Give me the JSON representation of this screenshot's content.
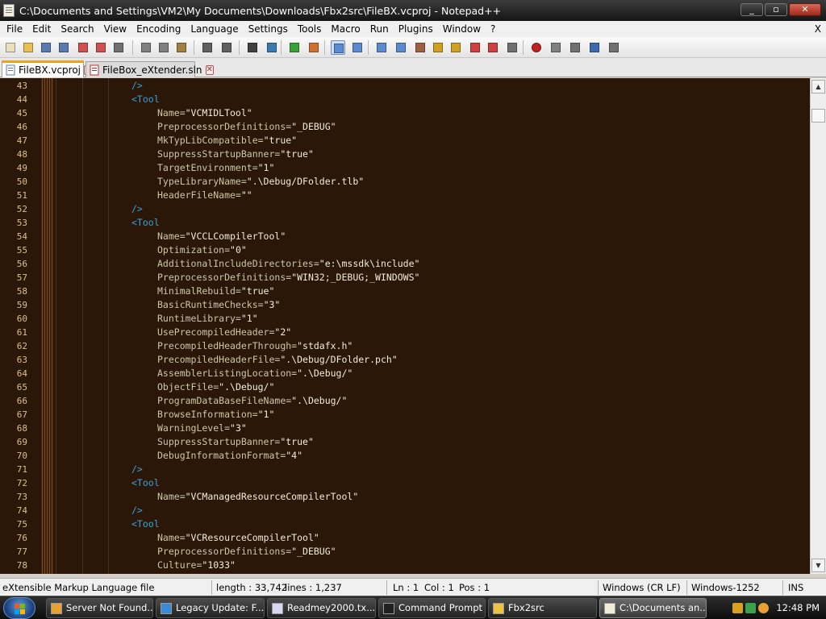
{
  "window": {
    "title": "C:\\Documents and Settings\\VM2\\My Documents\\Downloads\\Fbx2src\\FileBX.vcproj - Notepad++",
    "buttons": {
      "minimize": "_",
      "maximize": "▫",
      "close": "✕"
    }
  },
  "menu": {
    "items": [
      "File",
      "Edit",
      "Search",
      "View",
      "Encoding",
      "Language",
      "Settings",
      "Tools",
      "Macro",
      "Run",
      "Plugins",
      "Window",
      "?"
    ],
    "close": "X"
  },
  "toolbar": {
    "icons": [
      "new-file-icon",
      "open-file-icon",
      "save-icon",
      "save-all-icon",
      "close-icon",
      "close-all-icon",
      "print-icon",
      "cut-icon",
      "copy-icon",
      "paste-icon",
      "undo-icon",
      "redo-icon",
      "find-icon",
      "replace-icon",
      "zoom-in-icon",
      "zoom-out-icon",
      "sync-vertical-icon",
      "sync-horizontal-icon",
      "word-wrap-icon",
      "show-all-chars-icon",
      "indent-guide-icon",
      "user-language-icon",
      "doc-map-icon",
      "function-list-icon",
      "folder-workspace-icon",
      "monitoring-icon",
      "record-macro-icon",
      "stop-macro-icon",
      "play-macro-icon",
      "run-multiple-macro-icon",
      "save-macro-icon"
    ]
  },
  "tabs": [
    {
      "label": "FileBX.vcproj",
      "active": true
    },
    {
      "label": "FileBox_eXtender.sln",
      "active": false
    }
  ],
  "editor": {
    "colors": {
      "background": "#2b1708",
      "tag": "#3aa0d8",
      "attribute": "#cfc6a8",
      "value": "#f2ecd8",
      "line_number": "#d8c08c"
    },
    "lines": [
      {
        "n": "43",
        "indent": 3,
        "parts": [
          {
            "t": "tag",
            "s": "/>"
          }
        ]
      },
      {
        "n": "44",
        "indent": 3,
        "parts": [
          {
            "t": "tag",
            "s": "<Tool"
          }
        ]
      },
      {
        "n": "45",
        "indent": 4,
        "parts": [
          {
            "t": "attr",
            "s": "Name="
          },
          {
            "t": "val",
            "s": "\"VCMIDLTool\""
          }
        ]
      },
      {
        "n": "46",
        "indent": 4,
        "parts": [
          {
            "t": "attr",
            "s": "PreprocessorDefinitions="
          },
          {
            "t": "val",
            "s": "\"_DEBUG\""
          }
        ]
      },
      {
        "n": "47",
        "indent": 4,
        "parts": [
          {
            "t": "attr",
            "s": "MkTypLibCompatible="
          },
          {
            "t": "val",
            "s": "\"true\""
          }
        ]
      },
      {
        "n": "48",
        "indent": 4,
        "parts": [
          {
            "t": "attr",
            "s": "SuppressStartupBanner="
          },
          {
            "t": "val",
            "s": "\"true\""
          }
        ]
      },
      {
        "n": "49",
        "indent": 4,
        "parts": [
          {
            "t": "attr",
            "s": "TargetEnvironment="
          },
          {
            "t": "val",
            "s": "\"1\""
          }
        ]
      },
      {
        "n": "50",
        "indent": 4,
        "parts": [
          {
            "t": "attr",
            "s": "TypeLibraryName="
          },
          {
            "t": "val",
            "s": "\".\\Debug/DFolder.tlb\""
          }
        ]
      },
      {
        "n": "51",
        "indent": 4,
        "parts": [
          {
            "t": "attr",
            "s": "HeaderFileName="
          },
          {
            "t": "val",
            "s": "\"\""
          }
        ]
      },
      {
        "n": "52",
        "indent": 3,
        "parts": [
          {
            "t": "tag",
            "s": "/>"
          }
        ]
      },
      {
        "n": "53",
        "indent": 3,
        "parts": [
          {
            "t": "tag",
            "s": "<Tool"
          }
        ]
      },
      {
        "n": "54",
        "indent": 4,
        "parts": [
          {
            "t": "attr",
            "s": "Name="
          },
          {
            "t": "val",
            "s": "\"VCCLCompilerTool\""
          }
        ]
      },
      {
        "n": "55",
        "indent": 4,
        "parts": [
          {
            "t": "attr",
            "s": "Optimization="
          },
          {
            "t": "val",
            "s": "\"0\""
          }
        ]
      },
      {
        "n": "56",
        "indent": 4,
        "parts": [
          {
            "t": "attr",
            "s": "AdditionalIncludeDirectories="
          },
          {
            "t": "val",
            "s": "\"e:\\mssdk\\include\""
          }
        ]
      },
      {
        "n": "57",
        "indent": 4,
        "parts": [
          {
            "t": "attr",
            "s": "PreprocessorDefinitions="
          },
          {
            "t": "val",
            "s": "\"WIN32;_DEBUG;_WINDOWS\""
          }
        ]
      },
      {
        "n": "58",
        "indent": 4,
        "parts": [
          {
            "t": "attr",
            "s": "MinimalRebuild="
          },
          {
            "t": "val",
            "s": "\"true\""
          }
        ]
      },
      {
        "n": "59",
        "indent": 4,
        "parts": [
          {
            "t": "attr",
            "s": "BasicRuntimeChecks="
          },
          {
            "t": "val",
            "s": "\"3\""
          }
        ]
      },
      {
        "n": "60",
        "indent": 4,
        "parts": [
          {
            "t": "attr",
            "s": "RuntimeLibrary="
          },
          {
            "t": "val",
            "s": "\"1\""
          }
        ]
      },
      {
        "n": "61",
        "indent": 4,
        "parts": [
          {
            "t": "attr",
            "s": "UsePrecompiledHeader="
          },
          {
            "t": "val",
            "s": "\"2\""
          }
        ]
      },
      {
        "n": "62",
        "indent": 4,
        "parts": [
          {
            "t": "attr",
            "s": "PrecompiledHeaderThrough="
          },
          {
            "t": "val",
            "s": "\"stdafx.h\""
          }
        ]
      },
      {
        "n": "63",
        "indent": 4,
        "parts": [
          {
            "t": "attr",
            "s": "PrecompiledHeaderFile="
          },
          {
            "t": "val",
            "s": "\".\\Debug/DFolder.pch\""
          }
        ]
      },
      {
        "n": "64",
        "indent": 4,
        "parts": [
          {
            "t": "attr",
            "s": "AssemblerListingLocation="
          },
          {
            "t": "val",
            "s": "\".\\Debug/\""
          }
        ]
      },
      {
        "n": "65",
        "indent": 4,
        "parts": [
          {
            "t": "attr",
            "s": "ObjectFile="
          },
          {
            "t": "val",
            "s": "\".\\Debug/\""
          }
        ]
      },
      {
        "n": "66",
        "indent": 4,
        "parts": [
          {
            "t": "attr",
            "s": "ProgramDataBaseFileName="
          },
          {
            "t": "val",
            "s": "\".\\Debug/\""
          }
        ]
      },
      {
        "n": "67",
        "indent": 4,
        "parts": [
          {
            "t": "attr",
            "s": "BrowseInformation="
          },
          {
            "t": "val",
            "s": "\"1\""
          }
        ]
      },
      {
        "n": "68",
        "indent": 4,
        "parts": [
          {
            "t": "attr",
            "s": "WarningLevel="
          },
          {
            "t": "val",
            "s": "\"3\""
          }
        ]
      },
      {
        "n": "69",
        "indent": 4,
        "parts": [
          {
            "t": "attr",
            "s": "SuppressStartupBanner="
          },
          {
            "t": "val",
            "s": "\"true\""
          }
        ]
      },
      {
        "n": "70",
        "indent": 4,
        "parts": [
          {
            "t": "attr",
            "s": "DebugInformationFormat="
          },
          {
            "t": "val",
            "s": "\"4\""
          }
        ]
      },
      {
        "n": "71",
        "indent": 3,
        "parts": [
          {
            "t": "tag",
            "s": "/>"
          }
        ]
      },
      {
        "n": "72",
        "indent": 3,
        "parts": [
          {
            "t": "tag",
            "s": "<Tool"
          }
        ]
      },
      {
        "n": "73",
        "indent": 4,
        "parts": [
          {
            "t": "attr",
            "s": "Name="
          },
          {
            "t": "val",
            "s": "\"VCManagedResourceCompilerTool\""
          }
        ]
      },
      {
        "n": "74",
        "indent": 3,
        "parts": [
          {
            "t": "tag",
            "s": "/>"
          }
        ]
      },
      {
        "n": "75",
        "indent": 3,
        "parts": [
          {
            "t": "tag",
            "s": "<Tool"
          }
        ]
      },
      {
        "n": "76",
        "indent": 4,
        "parts": [
          {
            "t": "attr",
            "s": "Name="
          },
          {
            "t": "val",
            "s": "\"VCResourceCompilerTool\""
          }
        ]
      },
      {
        "n": "77",
        "indent": 4,
        "parts": [
          {
            "t": "attr",
            "s": "PreprocessorDefinitions="
          },
          {
            "t": "val",
            "s": "\"_DEBUG\""
          }
        ]
      },
      {
        "n": "78",
        "indent": 4,
        "parts": [
          {
            "t": "attr",
            "s": "Culture="
          },
          {
            "t": "val",
            "s": "\"1033\""
          }
        ]
      }
    ]
  },
  "status": {
    "filetype": "eXtensible Markup Language file",
    "length": "length : 33,742",
    "lines": "lines : 1,237",
    "ln": "Ln : 1",
    "col": "Col : 1",
    "pos": "Pos : 1",
    "eol": "Windows (CR LF)",
    "encoding": "Windows-1252",
    "mode": "INS"
  },
  "taskbar": {
    "tasks": [
      {
        "label": "Server Not Found...",
        "icon": "browser-icon",
        "active": false
      },
      {
        "label": "Legacy Update: F...",
        "icon": "internet-explorer-icon",
        "active": false
      },
      {
        "label": "Readmey2000.tx...",
        "icon": "text-document-icon",
        "active": false
      },
      {
        "label": "Command Prompt",
        "icon": "command-prompt-icon",
        "active": false
      },
      {
        "label": "Fbx2src",
        "icon": "folder-icon",
        "active": false
      },
      {
        "label": "C:\\Documents an...",
        "icon": "notepad-icon",
        "active": true
      }
    ],
    "clock": "12:48 PM"
  }
}
